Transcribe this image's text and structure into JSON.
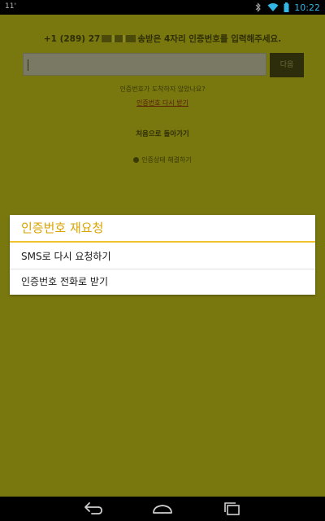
{
  "status_bar": {
    "left_indicator": "11'",
    "time": "10:22",
    "icons": [
      "bluetooth-icon",
      "wifi-icon",
      "battery-icon"
    ]
  },
  "app": {
    "instruction_before": "+1 (289) 27",
    "instruction_after": "송받은 4자리 인증번호를 입력해주세요.",
    "code_input_value": "",
    "next_button_label": "다음",
    "hint_text": "인증번호가 도착하지 않았나요?",
    "resend_link": "인증번호 다시 받기",
    "back_home": "처음으로 돌아가기",
    "auth_status": "인증상태 해결하기"
  },
  "dialog": {
    "title": "인증번호 재요청",
    "options": [
      "SMS로 다시 요청하기",
      "인증번호 전화로 받기"
    ]
  },
  "nav_bar": {
    "buttons": [
      "back-icon",
      "home-icon",
      "recents-icon"
    ]
  },
  "colors": {
    "overlay_olive": "#79780f",
    "dialog_accent": "#d9a300",
    "divider_accent": "#f0c22e",
    "status_time": "#33b5e5"
  }
}
